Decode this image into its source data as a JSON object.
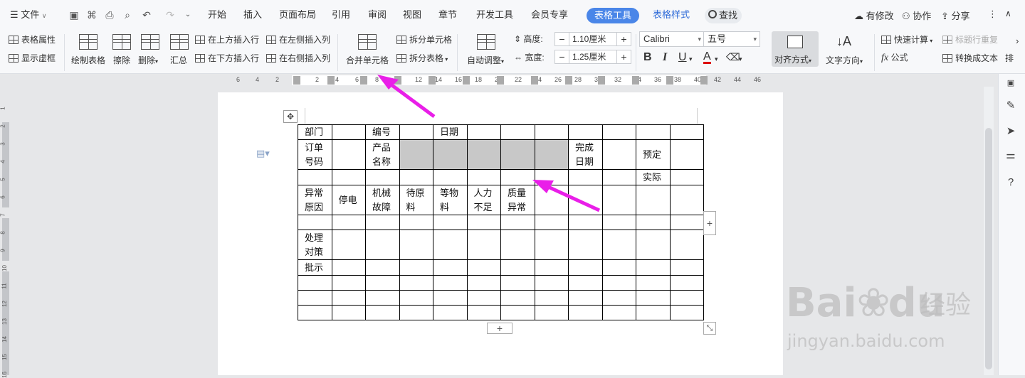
{
  "topbar": {
    "file_menu": "文件",
    "tabs": [
      "开始",
      "插入",
      "页面布局",
      "引用",
      "审阅",
      "视图",
      "章节",
      "开发工具",
      "会员专享"
    ],
    "active_tab": "表格工具",
    "extra_tab": "表格样式",
    "search": "查找",
    "right": {
      "changes": "有修改",
      "collab": "协作",
      "share": "分享"
    }
  },
  "ribbon": {
    "table_props": "表格属性",
    "show_gridlines": "显示虚框",
    "draw_table": "绘制表格",
    "erase": "擦除",
    "delete": "删除",
    "summary": "汇总",
    "insert_above": "在上方插入行",
    "insert_below": "在下方插入行",
    "insert_left": "在左侧插入列",
    "insert_right": "在右侧插入列",
    "merge_cells": "合并单元格",
    "split_cells": "拆分单元格",
    "split_table": "拆分表格",
    "auto_fit": "自动调整",
    "height_label": "高度:",
    "height_value": "1.10厘米",
    "width_label": "宽度:",
    "width_value": "1.25厘米",
    "font_name": "Calibri",
    "font_size": "五号",
    "bold": "B",
    "italic": "I",
    "underline": "U",
    "font_color": "A",
    "align": "对齐方式",
    "text_dir": "文字方向",
    "quick_calc": "快速计算",
    "repeat_header": "标题行重复",
    "formula": "公式",
    "to_text": "转换成文本",
    "sort": "排"
  },
  "ruler": {
    "numbers": [
      "6",
      "4",
      "2",
      "2",
      "4",
      "6",
      "8",
      "12",
      "14",
      "16",
      "18",
      "20",
      "22",
      "24",
      "26",
      "28",
      "30",
      "32",
      "34",
      "36",
      "38",
      "40",
      "42",
      "44",
      "46"
    ]
  },
  "vruler": {
    "numbers": [
      "1",
      "2",
      "3",
      "4",
      "5",
      "6",
      "7",
      "8",
      "9",
      "10",
      "11",
      "12",
      "13",
      "14",
      "15",
      "16"
    ]
  },
  "table": {
    "rows": [
      [
        "部门",
        "",
        "编号",
        "",
        "日期",
        "",
        "",
        "",
        "",
        "",
        "",
        ""
      ],
      [
        "订单号码",
        "",
        "产品名称",
        "",
        "",
        "",
        "",
        "",
        "完成日期",
        "",
        "预定",
        ""
      ],
      [
        "",
        "",
        "",
        "",
        "",
        "",
        "",
        "",
        "",
        "",
        "实际",
        ""
      ],
      [
        "异常原因",
        "停电",
        "机械故障",
        "待原料",
        "等物料",
        "人力不足",
        "质量异常",
        "",
        "",
        "",
        "",
        ""
      ],
      [
        "",
        "",
        "",
        "",
        "",
        "",
        "",
        "",
        "",
        "",
        "",
        ""
      ],
      [
        "处理对策",
        "",
        "",
        "",
        "",
        "",
        "",
        "",
        "",
        "",
        "",
        ""
      ],
      [
        "批示",
        "",
        "",
        "",
        "",
        "",
        "",
        "",
        "",
        "",
        "",
        ""
      ],
      [
        "",
        "",
        "",
        "",
        "",
        "",
        "",
        "",
        "",
        "",
        "",
        ""
      ],
      [
        "",
        "",
        "",
        "",
        "",
        "",
        "",
        "",
        "",
        "",
        "",
        ""
      ],
      [
        "",
        "",
        "",
        "",
        "",
        "",
        "",
        "",
        "",
        "",
        "",
        ""
      ]
    ]
  },
  "annotation": {
    "arrow_color": "#e91ee8"
  },
  "watermark": {
    "brand": "Bai",
    "brand2": "du",
    "cn": "经验",
    "url": "jingyan.baidu.com"
  }
}
